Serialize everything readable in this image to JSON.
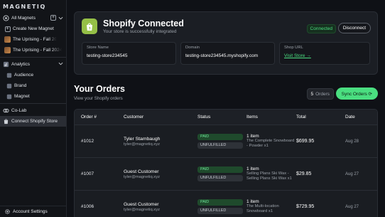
{
  "brand": {
    "logo": "MAGNETIQ"
  },
  "sidebar": {
    "all_magnets": "All Magnets",
    "create": "Create New Magnet",
    "magnets": [
      "The Uprising - Fall 20",
      "The Uprising - Fall 2024"
    ],
    "analytics": "Analytics",
    "analytics_items": [
      "Audience",
      "Brand",
      "Magnet"
    ],
    "colab": "Co-Lab",
    "shopify": "Connect Shopify Store",
    "account": "Account Settings"
  },
  "connection": {
    "title": "Shopify Connected",
    "subtitle": "Your store is successfully integrated",
    "status": "Connected",
    "disconnect": "Disconnect",
    "store_name_label": "Store Name",
    "store_name": "testing-store234545",
    "domain_label": "Domain",
    "domain": "testing-store234545.myshopify.com",
    "shop_url_label": "Shop URL",
    "shop_url": "Visit Store →",
    "accent": "#4ade80",
    "shopify_green": "#95bf47"
  },
  "orders": {
    "title": "Your Orders",
    "subtitle": "View your Shopify orders",
    "count": "5",
    "count_label": "Orders",
    "sync": "Sync Orders ⟳",
    "columns": [
      "Order #",
      "Customer",
      "Status",
      "Items",
      "Total",
      "Date"
    ],
    "rows": [
      {
        "id": "#1012",
        "name": "Tyler Stambaugh",
        "email": "tyler@magnetiq.xyz",
        "paid": "PAID",
        "fulfill": "UNFULFILLED",
        "count": "1 item",
        "desc": "The Complete Snowboard - Powder x1",
        "total": "$699.95",
        "date": "Aug 28"
      },
      {
        "id": "#1007",
        "name": "Guest Customer",
        "email": "tyler@magnetiq.xyz",
        "paid": "PAID",
        "fulfill": "UNFULFILLED",
        "count": "1 item",
        "desc": "Selling Plans Ski Wax - Selling Plans Ski Wax x1",
        "total": "$29.85",
        "date": "Aug 27"
      },
      {
        "id": "#1006",
        "name": "Guest Customer",
        "email": "tyler@magnetiq.xyz",
        "paid": "PAID",
        "fulfill": "UNFULFILLED",
        "count": "1 item",
        "desc": "The Multi-location Snowboard x1",
        "total": "$729.95",
        "date": "Aug 27"
      }
    ]
  }
}
